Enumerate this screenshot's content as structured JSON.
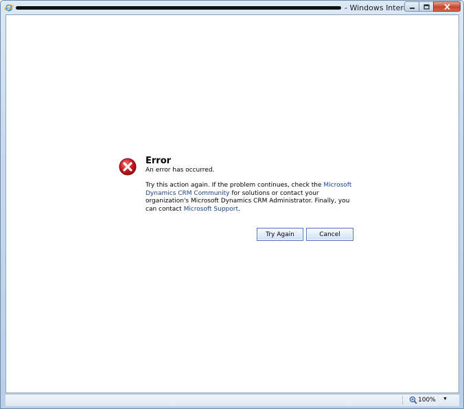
{
  "window": {
    "title": "- Windows Interne...",
    "icon": "internet-explorer-icon"
  },
  "caption_buttons": {
    "minimize": "minimize-icon",
    "maximize": "maximize-icon",
    "close": "close-icon"
  },
  "error": {
    "icon": "error-x-icon",
    "title": "Error",
    "subtitle": "An error has occurred.",
    "message_part1": "Try this action again. If the problem continues, check the ",
    "link1": "Microsoft Dynamics CRM Community",
    "message_part2": " for solutions or contact your organization's Microsoft Dynamics CRM Administrator. Finally, you can contact ",
    "link2": "Microsoft Support",
    "message_part3": "."
  },
  "buttons": {
    "try_again": "Try Again",
    "cancel": "Cancel"
  },
  "statusbar": {
    "zoom_label": "100%",
    "zoom_icon": "zoom-icon"
  },
  "colors": {
    "link": "#15428b",
    "error_red": "#c4161c",
    "button_border": "#4b79b7"
  }
}
